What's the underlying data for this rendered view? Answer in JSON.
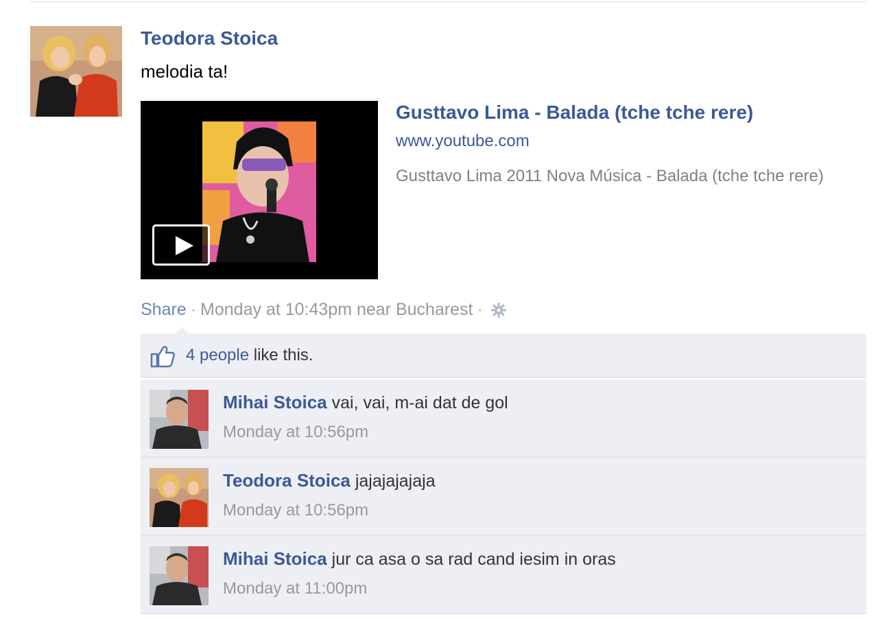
{
  "post": {
    "author": "Teodora Stoica",
    "message": "melodia ta!",
    "link": {
      "title": "Gusttavo Lima - Balada (tche tche rere)",
      "domain": "www.youtube.com",
      "description": "Gusttavo Lima 2011 Nova Música - Balada (tche tche rere)"
    },
    "actions": {
      "share": "Share",
      "separator": "·",
      "timestamp": "Monday at 10:43pm near Bucharest"
    }
  },
  "likes": {
    "count_text": "4 people",
    "suffix": "like this."
  },
  "comments": [
    {
      "author": "Mihai Stoica",
      "text": "vai, vai, m-ai dat de gol",
      "time": "Monday at 10:56pm"
    },
    {
      "author": "Teodora Stoica",
      "text": "jajajajajaja",
      "time": "Monday at 10:56pm"
    },
    {
      "author": "Mihai Stoica",
      "text": "jur ca asa o sa rad cand iesim in oras",
      "time": "Monday at 11:00pm"
    }
  ],
  "icons": {
    "play": "play-icon",
    "gear": "gear-icon",
    "like": "thumbs-up-icon"
  },
  "colors": {
    "link_blue": "#3b5998",
    "comment_bg": "#edeff4",
    "meta_gray": "#999999"
  }
}
